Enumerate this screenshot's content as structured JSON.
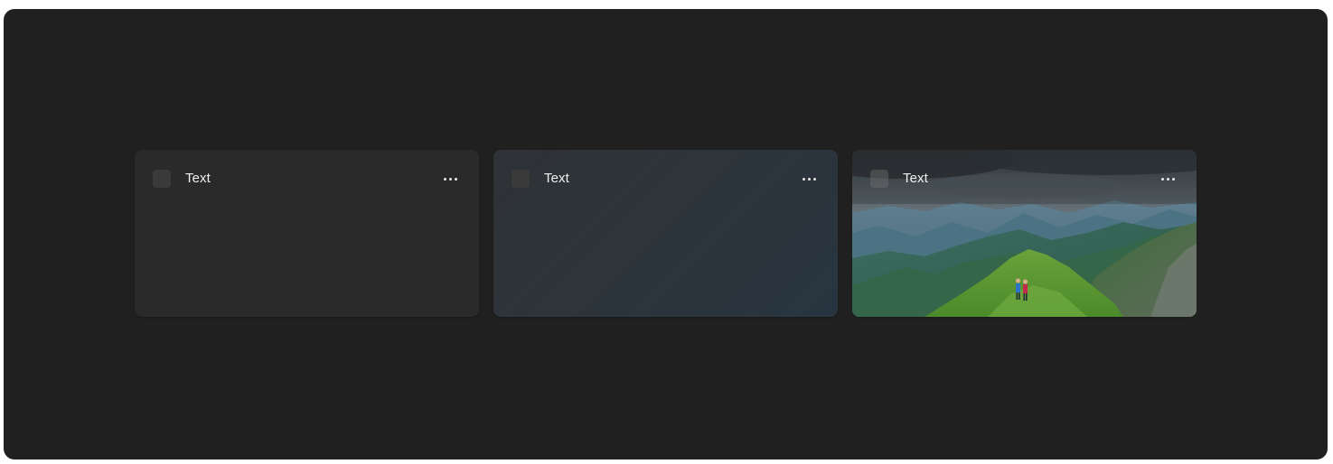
{
  "cards": [
    {
      "title": "Text",
      "background": "solid",
      "more_icon": "more-horizontal-icon"
    },
    {
      "title": "Text",
      "background": "gradient",
      "more_icon": "more-horizontal-icon"
    },
    {
      "title": "Text",
      "background": "image",
      "image_subject": "mountain-ridge-hikers-photo",
      "more_icon": "more-horizontal-icon"
    }
  ],
  "colors": {
    "frame_background": "#202020",
    "card_solid": "#2a2a2a",
    "card_gradient_start": "#2f3236",
    "card_gradient_end": "#283540",
    "text": "#f0f0f0"
  }
}
